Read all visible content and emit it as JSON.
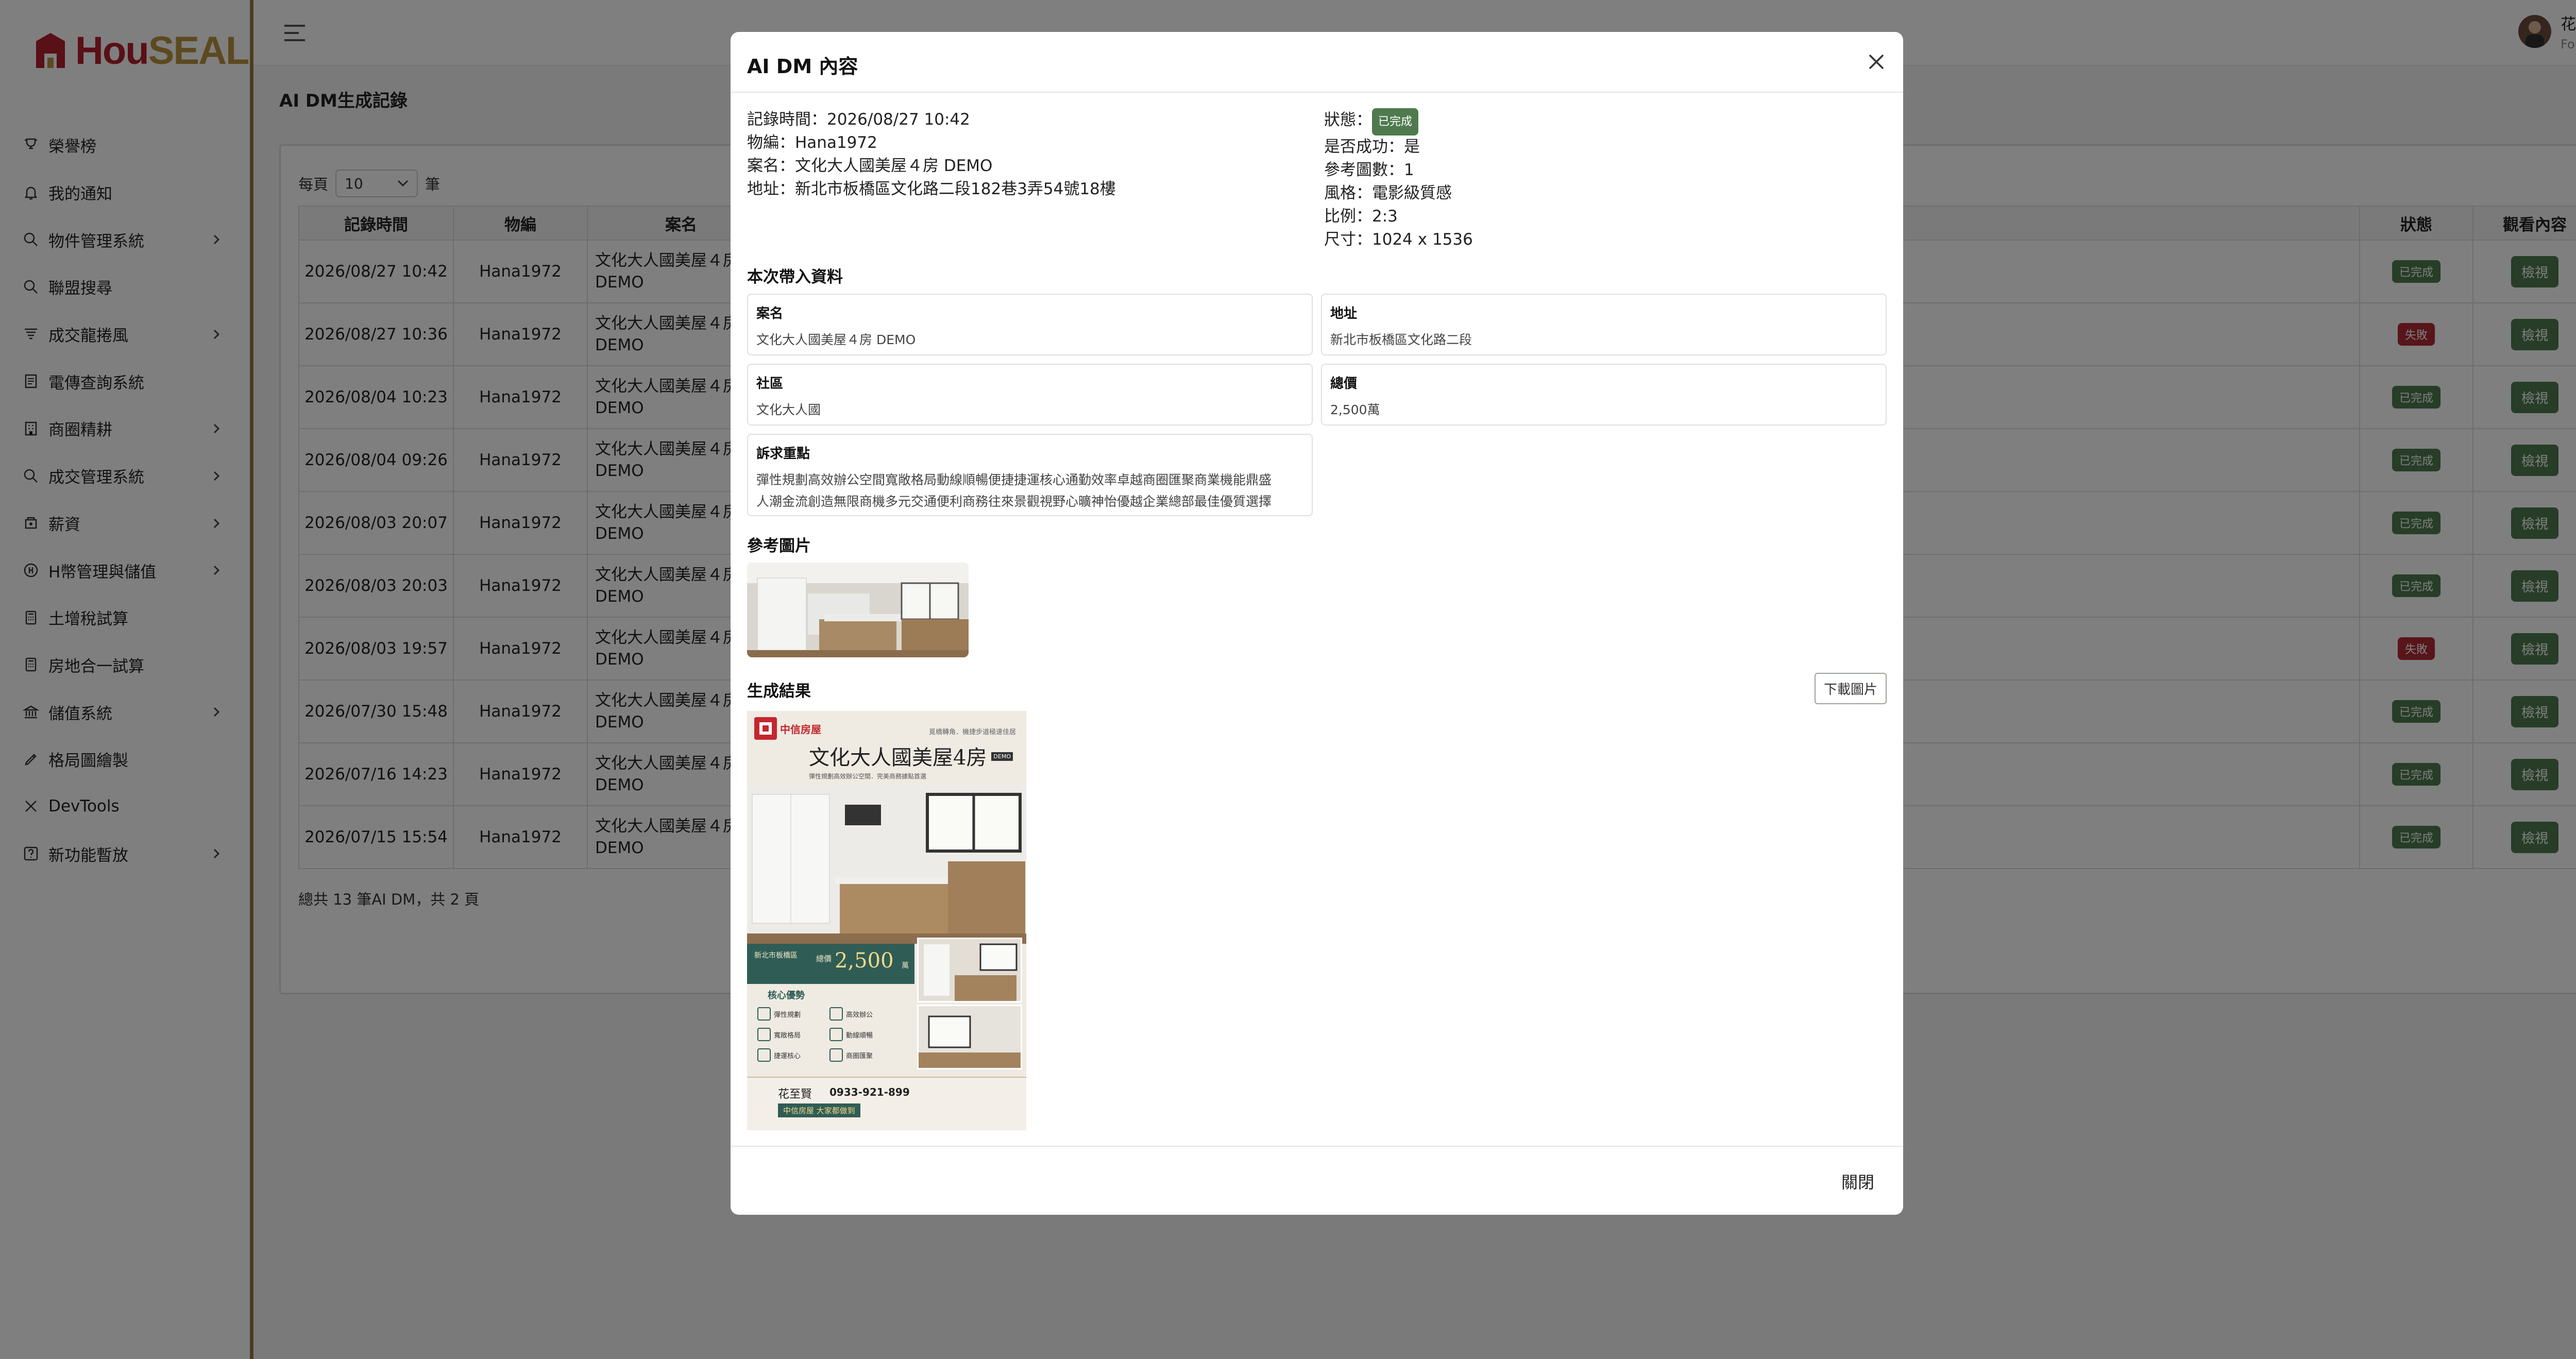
{
  "brand": {
    "name_part1": "Hou",
    "name_part2": "SEAL"
  },
  "topbar": {
    "user_name": "花至賢",
    "user_role": "Founder"
  },
  "sidebar": {
    "items": [
      {
        "label": "榮譽榜",
        "icon": "trophy-icon",
        "has_children": false
      },
      {
        "label": "我的通知",
        "icon": "bell-icon",
        "has_children": false
      },
      {
        "label": "物件管理系統",
        "icon": "search-icon",
        "has_children": true
      },
      {
        "label": "聯盟搜尋",
        "icon": "search-icon",
        "has_children": false
      },
      {
        "label": "成交龍捲風",
        "icon": "tornado-icon",
        "has_children": true
      },
      {
        "label": "電傳查詢系統",
        "icon": "document-icon",
        "has_children": false
      },
      {
        "label": "商圈精耕",
        "icon": "building-icon",
        "has_children": true
      },
      {
        "label": "成交管理系統",
        "icon": "search-icon",
        "has_children": true
      },
      {
        "label": "薪資",
        "icon": "salary-icon",
        "has_children": true
      },
      {
        "label": "H幣管理與儲值",
        "icon": "coin-icon",
        "has_children": true
      },
      {
        "label": "土增稅試算",
        "icon": "calculator-icon",
        "has_children": false
      },
      {
        "label": "房地合一試算",
        "icon": "calculator-icon",
        "has_children": false
      },
      {
        "label": "儲值系統",
        "icon": "bank-icon",
        "has_children": true
      },
      {
        "label": "格局圖繪製",
        "icon": "pen-icon",
        "has_children": false
      },
      {
        "label": "DevTools",
        "icon": "tools-icon",
        "has_children": false
      },
      {
        "label": "新功能暫放",
        "icon": "question-icon",
        "has_children": true
      }
    ]
  },
  "page": {
    "title": "AI DM生成記錄"
  },
  "list": {
    "per_page_label": "每頁",
    "per_page_value": "10",
    "per_page_unit": "筆",
    "columns": {
      "time": "記錄時間",
      "code": "物編",
      "name": "案名",
      "status": "狀態",
      "view": "觀看內容"
    },
    "view_label": "檢視",
    "rows": [
      {
        "time": "2026/08/27 10:42",
        "code": "Hana1972",
        "name": "文化大人國美屋４房 DEMO",
        "status": "已完成",
        "status_type": "ok"
      },
      {
        "time": "2026/08/27 10:36",
        "code": "Hana1972",
        "name": "文化大人國美屋４房 DEMO",
        "status": "失敗",
        "status_type": "fail"
      },
      {
        "time": "2026/08/04 10:23",
        "code": "Hana1972",
        "name": "文化大人國美屋４房 DEMO",
        "status": "已完成",
        "status_type": "ok"
      },
      {
        "time": "2026/08/04 09:26",
        "code": "Hana1972",
        "name": "文化大人國美屋４房 DEMO",
        "status": "已完成",
        "status_type": "ok"
      },
      {
        "time": "2026/08/03 20:07",
        "code": "Hana1972",
        "name": "文化大人國美屋４房 DEMO",
        "status": "已完成",
        "status_type": "ok"
      },
      {
        "time": "2026/08/03 20:03",
        "code": "Hana1972",
        "name": "文化大人國美屋４房 DEMO",
        "status": "已完成",
        "status_type": "ok"
      },
      {
        "time": "2026/08/03 19:57",
        "code": "Hana1972",
        "name": "文化大人國美屋４房 DEMO",
        "status": "失敗",
        "status_type": "fail"
      },
      {
        "time": "2026/07/30 15:48",
        "code": "Hana1972",
        "name": "文化大人國美屋４房 DEMO",
        "status": "已完成",
        "status_type": "ok"
      },
      {
        "time": "2026/07/16 14:23",
        "code": "Hana1972",
        "name": "文化大人國美屋４房 DEMO",
        "status": "已完成",
        "status_type": "ok"
      },
      {
        "time": "2026/07/15 15:54",
        "code": "Hana1972",
        "name": "文化大人國美屋４房 DEMO",
        "status": "已完成",
        "status_type": "ok"
      }
    ],
    "total_text": "總共 13 筆AI DM，共 2 頁"
  },
  "colors": {
    "brand_red": "#b3202c",
    "brand_gold": "#b8923f",
    "success": "#4e7a4e",
    "danger": "#b02a35"
  },
  "modal": {
    "title": "AI DM 內容",
    "left_info": [
      {
        "label": "記錄時間：",
        "value": "2026/08/27 10:42"
      },
      {
        "label": "物編：",
        "value": "Hana1972"
      },
      {
        "label": "案名：",
        "value": "文化大人國美屋４房 DEMO"
      },
      {
        "label": "地址：",
        "value": "新北市板橋區文化路二段182巷3弄54號18樓"
      }
    ],
    "status_label": "狀態：",
    "status_value": "已完成",
    "right_info": [
      {
        "label": "是否成功：",
        "value": "是"
      },
      {
        "label": "參考圖數：",
        "value": "1"
      },
      {
        "label": "風格：",
        "value": "電影級質感"
      },
      {
        "label": "比例：",
        "value": "2:3"
      },
      {
        "label": "尺寸：",
        "value": "1024 x 1536"
      }
    ],
    "input_section_title": "本次帶入資料",
    "fields": {
      "case_name": {
        "label": "案名",
        "value": "文化大人國美屋４房 DEMO"
      },
      "address": {
        "label": "地址",
        "value": "新北市板橋區文化路二段"
      },
      "community": {
        "label": "社區",
        "value": "文化大人國"
      },
      "price": {
        "label": "總價",
        "value": "2,500萬"
      },
      "appeal": {
        "label": "訴求重點",
        "line1": "彈性規劃高效辦公空間寬敞格局動線順暢便捷捷運核心通勤效率卓越商圈匯聚商業機能鼎盛",
        "line2": "人潮金流創造無限商機多元交通便利商務往來景觀視野心曠神怡優越企業總部最佳優質選擇"
      }
    },
    "ref_section_title": "參考圖片",
    "result_section_title": "生成結果",
    "download_label": "下載圖片",
    "dm": {
      "brand": "中信房屋",
      "tagline": "覓橋轉角．機捷步道極速佳居",
      "title": "文化大人國美屋4房",
      "badge": "DEMO",
      "subtitle": "彈性規劃高效辦公空間．完美商務據點首選",
      "location": "新北市板橋區",
      "price_label": "總價",
      "price": "2,500",
      "price_unit": "萬",
      "section": "核心優勢",
      "features": [
        "彈性規劃",
        "高效辦公",
        "寬敞格局",
        "動線順暢",
        "捷運核心",
        "商圈匯聚"
      ],
      "agent": "花至賢",
      "phone": "0933-921-899",
      "slogan": "中信房屋 大家都做到"
    },
    "footer_close": "關閉"
  }
}
